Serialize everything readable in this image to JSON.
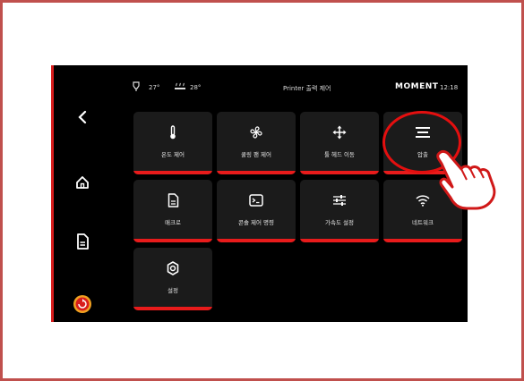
{
  "status": {
    "nozzle_temp": "27°",
    "bed_temp": "28°",
    "title": "Printer 출력 제어",
    "brand": "MOMENT",
    "time": "12:18"
  },
  "sidebar": [
    {
      "icon": "back-arrow-icon"
    },
    {
      "icon": "home-icon"
    },
    {
      "icon": "file-icon"
    },
    {
      "icon": "emergency-stop-icon"
    }
  ],
  "tiles": [
    {
      "label": "온도 제어",
      "icon": "thermometer-icon"
    },
    {
      "label": "쿨링 팬 제어",
      "icon": "fan-icon"
    },
    {
      "label": "툴 헤드 이동",
      "icon": "move-icon"
    },
    {
      "label": "압출",
      "icon": "extrude-icon"
    },
    {
      "label": "매크로",
      "icon": "macro-file-icon"
    },
    {
      "label": "콘솔 제어 명령",
      "icon": "console-icon"
    },
    {
      "label": "가속도 설정",
      "icon": "sliders-icon"
    },
    {
      "label": "네트워크",
      "icon": "wifi-icon"
    },
    {
      "label": "설정",
      "icon": "gear-icon"
    }
  ],
  "colors": {
    "accent": "#e81b1b",
    "tile_bg": "#1b1b1b",
    "frame": "#c0504d"
  }
}
